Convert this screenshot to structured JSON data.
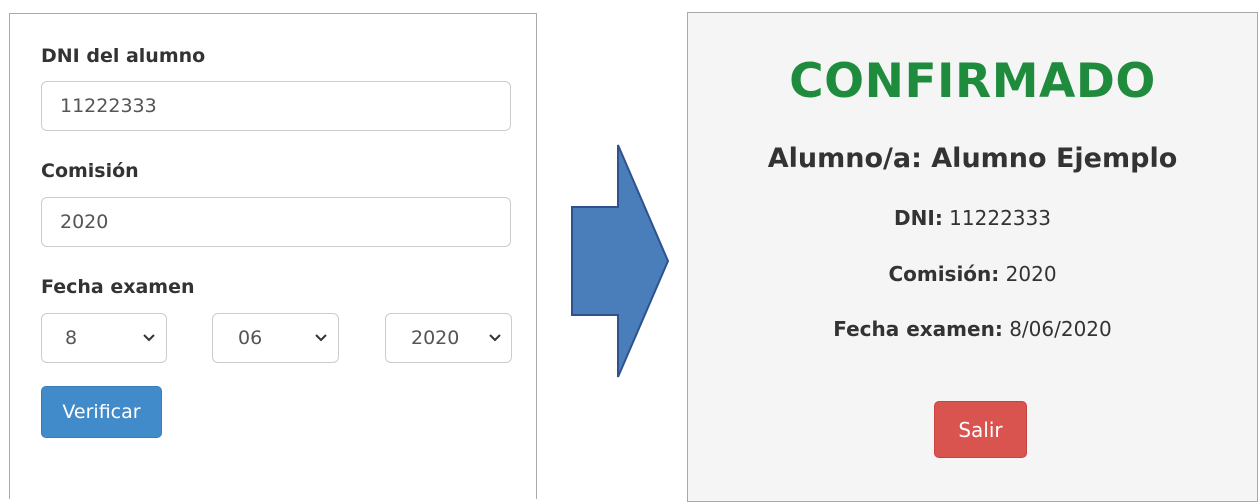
{
  "form": {
    "dni_label": "DNI del alumno",
    "dni_value": "11222333",
    "comision_label": "Comisión",
    "comision_value": "2020",
    "fecha_label": "Fecha examen",
    "day_value": "8",
    "month_value": "06",
    "year_value": "2020",
    "verify_label": "Verificar"
  },
  "result": {
    "status": "CONFIRMADO",
    "student_line": "Alumno/a: Alumno Ejemplo",
    "dni_label": "DNI:",
    "dni_value": "11222333",
    "comision_label": "Comisión:",
    "comision_value": "2020",
    "fecha_label": "Fecha examen:",
    "fecha_value": "8/06/2020",
    "exit_label": "Salir"
  },
  "colors": {
    "confirm_green": "#1f8b3d",
    "primary_blue": "#428bca",
    "danger_red": "#d9534f",
    "arrow_fill": "#4a7ebb"
  },
  "icons": [
    "chevron-down-icon",
    "right-arrow-icon"
  ]
}
